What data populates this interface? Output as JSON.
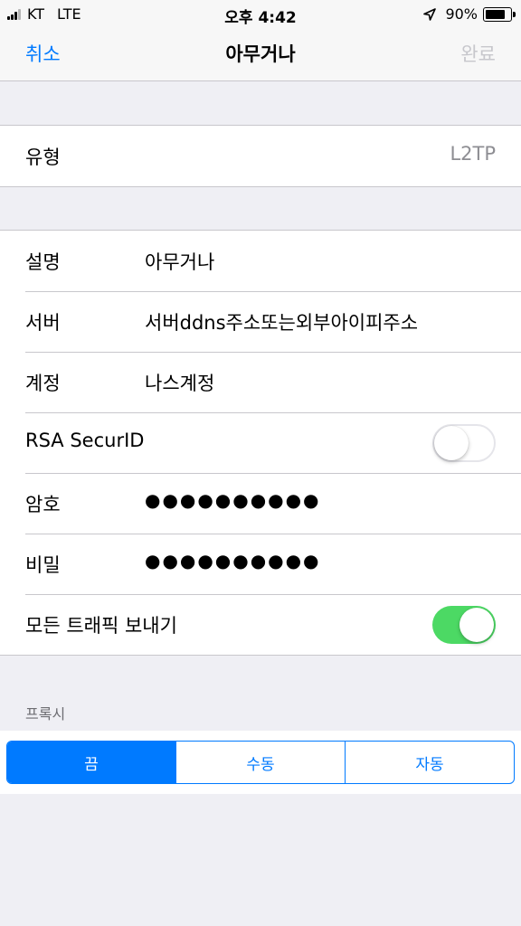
{
  "status_bar": {
    "carrier": "KT",
    "network": "LTE",
    "time": "오후 4:42",
    "battery": "90%",
    "battery_level": 0.9
  },
  "nav": {
    "cancel": "취소",
    "title": "아무거나",
    "done": "완료"
  },
  "type_row": {
    "label": "유형",
    "value": "L2TP"
  },
  "fields": {
    "description": {
      "label": "설명",
      "value": "아무거나"
    },
    "server": {
      "label": "서버",
      "value": "서버ddns주소또는외부아이피주소"
    },
    "account": {
      "label": "계정",
      "value": "나스계정"
    },
    "rsa": {
      "label": "RSA SecurID",
      "enabled": false
    },
    "password": {
      "label": "암호",
      "value": "●●●●●●●●●●"
    },
    "secret": {
      "label": "비밀",
      "value": "●●●●●●●●●●"
    },
    "send_all": {
      "label": "모든 트래픽 보내기",
      "enabled": true
    }
  },
  "proxy": {
    "header": "프록시",
    "options": [
      "끔",
      "수동",
      "자동"
    ],
    "selected": "끔"
  },
  "colors": {
    "accent": "#007aff",
    "toggle_on": "#4cd964",
    "disabled_text": "#c7c7cc",
    "background": "#efeff4"
  },
  "icons": {
    "signal": "cellular-signal-icon",
    "location": "location-arrow-icon",
    "battery": "battery-icon"
  }
}
